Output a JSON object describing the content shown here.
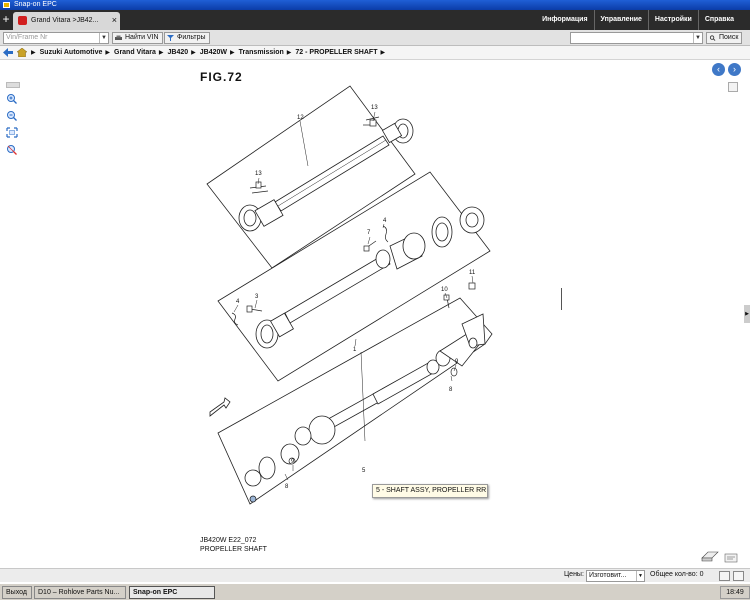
{
  "window": {
    "title": "Snap-on EPC"
  },
  "tabs": [
    {
      "label": "Grand Vitara >JB42..."
    }
  ],
  "top_menu": [
    "Информация",
    "Управление",
    "Настройки",
    "Справка"
  ],
  "toolbar": {
    "vin_placeholder": "Vin/Frame Nr",
    "find_vin_label": "Найти VIN",
    "filters_label": "Фильтры",
    "search_label": "Поиск"
  },
  "breadcrumb": [
    "Suzuki Automotive",
    "Grand Vitara",
    "JB420",
    "JB420W",
    "Transmission",
    "72 - PROPELLER SHAFT"
  ],
  "diagram": {
    "figure_title": "FIG.72",
    "figure_code": "JB420W E22_072",
    "figure_name": "PROPELLER SHAFT",
    "callouts": {
      "c12": "12",
      "c13a": "13",
      "c13b": "13",
      "c7": "7",
      "c4a": "4",
      "c11": "11",
      "c10": "10",
      "c4b": "4",
      "c3": "3",
      "c1": "1",
      "c9a": "9",
      "c8a": "8",
      "c5": "5",
      "c9b": "9",
      "c8b": "8"
    }
  },
  "tooltip": {
    "text": "5 - SHAFT ASSY, PROPELLER RR"
  },
  "status": {
    "prices_label": "Цены:",
    "prices_value": "Изготовит...",
    "total_label": "Общее кол-во:",
    "total_value": "0"
  },
  "taskbar": {
    "items": [
      "Выход",
      "D10 – Rohlove Parts Nu...",
      "Snap-on EPC"
    ],
    "clock": "18:49"
  }
}
